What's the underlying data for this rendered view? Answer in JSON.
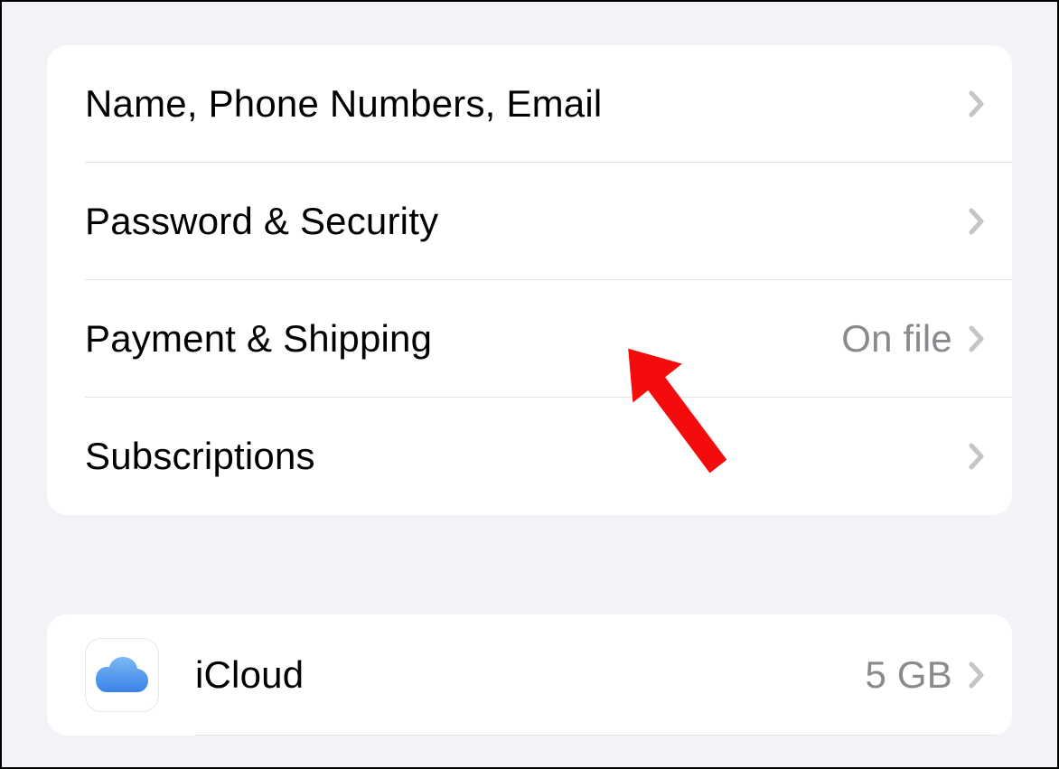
{
  "group1": {
    "rows": [
      {
        "label": "Name, Phone Numbers, Email",
        "detail": ""
      },
      {
        "label": "Password & Security",
        "detail": ""
      },
      {
        "label": "Payment & Shipping",
        "detail": "On file"
      },
      {
        "label": "Subscriptions",
        "detail": ""
      }
    ]
  },
  "group2": {
    "rows": [
      {
        "label": "iCloud",
        "detail": "5 GB",
        "icon": "icloud"
      }
    ]
  }
}
